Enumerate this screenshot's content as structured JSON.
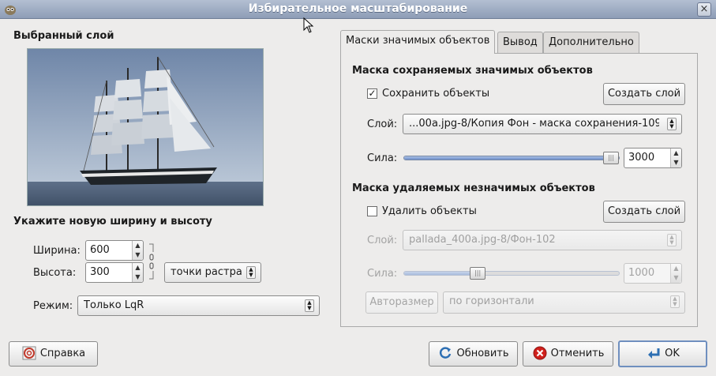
{
  "window": {
    "title": "Избирательное масштабирование",
    "close_glyph": "×"
  },
  "left": {
    "layer_heading": "Выбранный слой",
    "size_heading": "Укажите новую ширину и высоту",
    "width_label": "Ширина:",
    "width_value": "600",
    "height_label": "Высота:",
    "height_value": "300",
    "unit_value": "точки растра",
    "mode_label": "Режим:",
    "mode_value": "Только LqR"
  },
  "tabs": [
    {
      "label": "Маски значимых объектов"
    },
    {
      "label": "Вывод"
    },
    {
      "label": "Дополнительно"
    }
  ],
  "preserve": {
    "heading": "Маска сохраняемых значимых объектов",
    "checkbox_label": "Сохранить объекты",
    "checked": true,
    "create_layer": "Создать слой",
    "layer_label": "Слой:",
    "layer_value": "...00a.jpg-8/Копия Фон - маска сохранения-109",
    "strength_label": "Сила:",
    "strength_value": "3000",
    "strength_fraction": 1.0
  },
  "discard": {
    "heading": "Маска удаляемых незначимых объектов",
    "checkbox_label": "Удалить объекты",
    "checked": false,
    "create_layer": "Создать слой",
    "layer_label": "Слой:",
    "layer_value": "pallada_400a.jpg-8/Фон-102",
    "strength_label": "Сила:",
    "strength_value": "1000",
    "strength_fraction": 0.33,
    "autosize_button": "Авторазмер",
    "direction_value": "по горизонтали"
  },
  "footer": {
    "help": "Справка",
    "refresh": "Обновить",
    "cancel": "Отменить",
    "ok": "OK"
  },
  "icons": {
    "app": "gimp-icon",
    "help": "help-icon",
    "refresh": "refresh-icon",
    "cancel": "cancel-icon",
    "ok": "ok-icon",
    "chain": "chain-link-icon"
  }
}
